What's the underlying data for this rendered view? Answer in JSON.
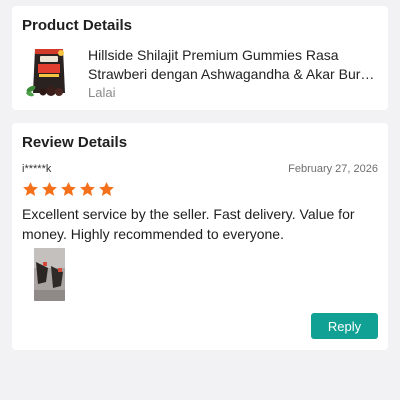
{
  "product_details": {
    "title": "Product Details",
    "product_name_line1": "Hillside Shilajit Premium Gummies Rasa",
    "product_name_line2": "Strawberi dengan Ashwagandha & Akar Burdock",
    "seller": "Lalai",
    "thumbnail_icon": "product-thumbnail-image"
  },
  "review_details": {
    "title": "Review Details",
    "reviewer": "i*****k",
    "date": "February 27, 2026",
    "rating": 5,
    "rating_max": 5,
    "star_color": "#f5701a",
    "text": "Excellent service by the seller. Fast delivery. Value for money. Highly recommended to everyone.",
    "photo_icon": "review-photo-image",
    "reply_label": "Reply",
    "reply_color": "#11a194"
  }
}
